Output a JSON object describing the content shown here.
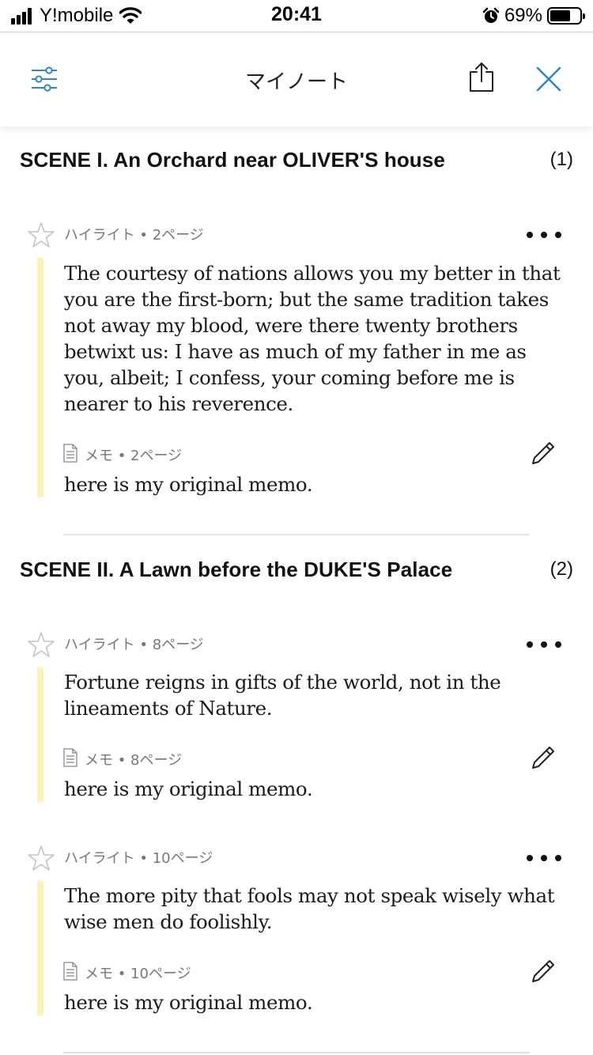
{
  "status_bar": {
    "carrier": "Y!mobile",
    "time": "20:41",
    "battery_percent": "69%",
    "battery_level": 0.69,
    "icons": [
      "signal-icon",
      "wifi-icon",
      "alarm-icon",
      "battery-icon"
    ]
  },
  "header": {
    "title": "マイノート",
    "icons": [
      "filter-icon",
      "share-icon",
      "close-icon"
    ],
    "accent_color": "#2a86d3"
  },
  "sections": [
    {
      "title": "SCENE I. An Orchard near OLIVER'S house",
      "count": "(1)",
      "notes": [
        {
          "meta": "ハイライト • 2ページ",
          "highlight": "The courtesy of nations allows you my better in that you are the first-born; but the same tradition takes not away my blood, were there twenty brothers betwixt us: I have as much of my father in me as you, albeit; I confess, your coming before me is nearer to his reverence.",
          "memo_meta": "メモ • 2ページ",
          "memo": "here is my original memo."
        }
      ]
    },
    {
      "title": "SCENE II. A Lawn before the DUKE'S Palace",
      "count": "(2)",
      "notes": [
        {
          "meta": "ハイライト • 8ページ",
          "highlight": "Fortune reigns in gifts of the world, not in the lineaments of Nature.",
          "memo_meta": "メモ • 8ページ",
          "memo": "here is my original memo."
        },
        {
          "meta": "ハイライト • 10ページ",
          "highlight": "The more pity that fools may not speak wisely what wise men do foolishly.",
          "memo_meta": "メモ • 10ページ",
          "memo": "here is my original memo."
        }
      ]
    }
  ],
  "colors": {
    "highlight_bar": "#fbf3b4",
    "icon_blue": "#2a86d3",
    "meta_gray": "#777777"
  }
}
